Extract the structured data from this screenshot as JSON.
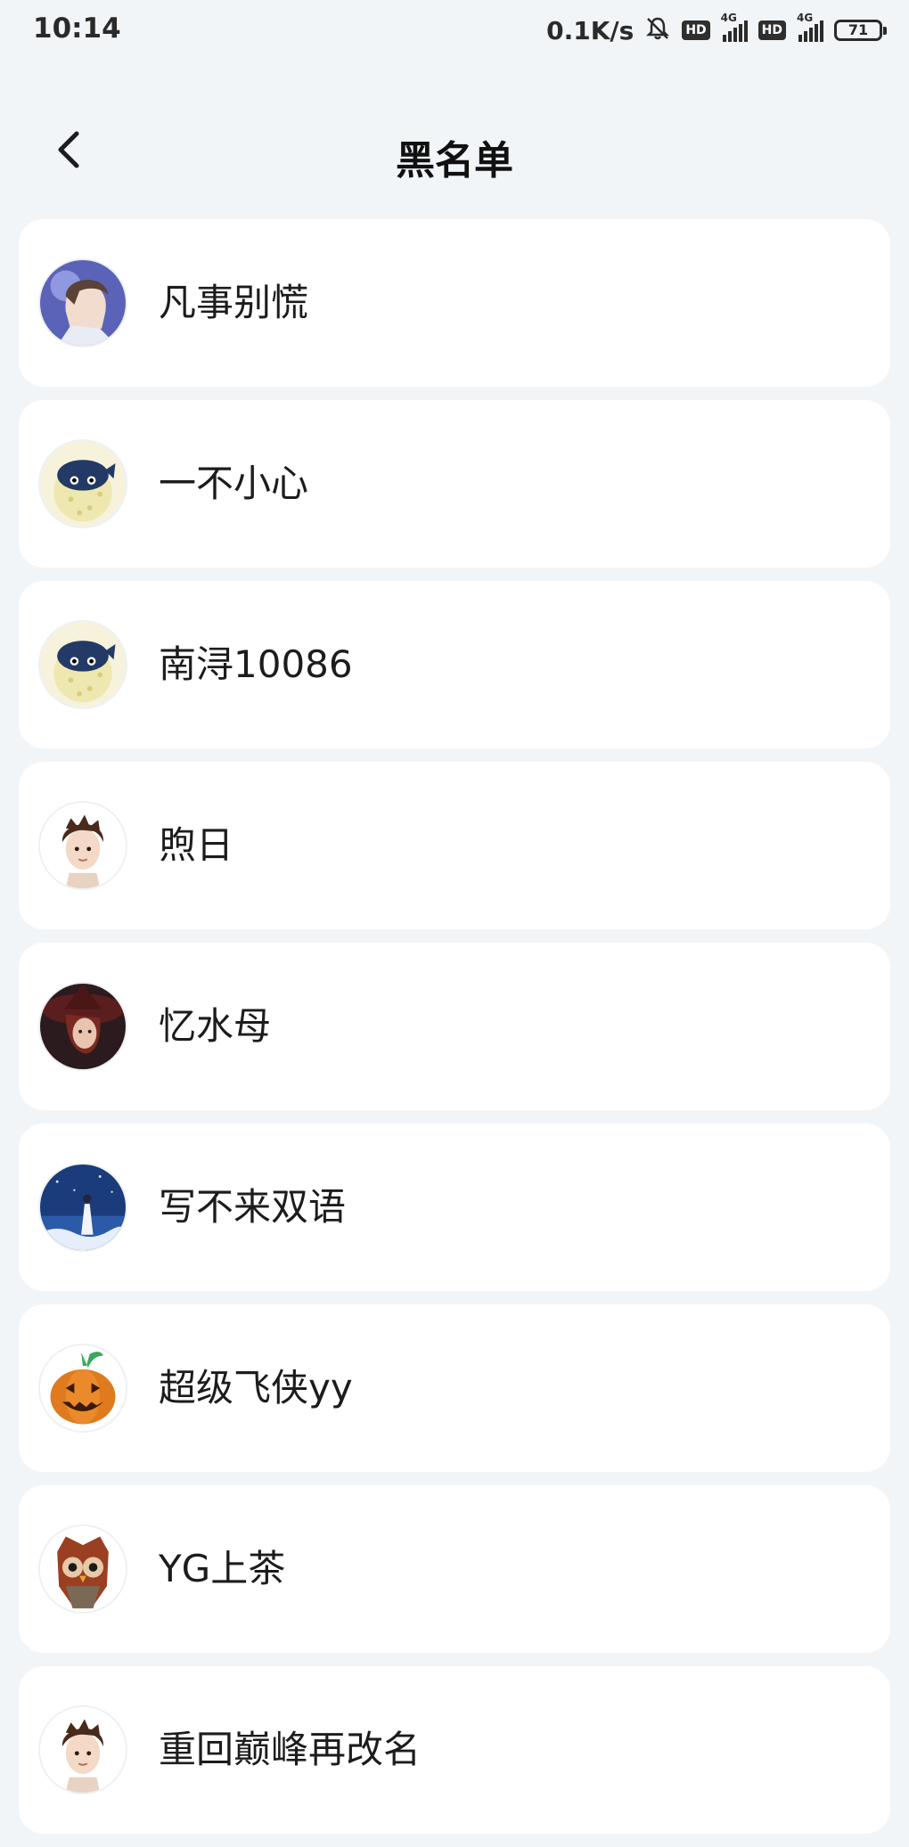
{
  "status_bar": {
    "time": "10:14",
    "net_speed": "0.1K/s",
    "hd1": "HD",
    "net1": "4G",
    "hd2": "HD",
    "net2": "4G",
    "battery": "71"
  },
  "header": {
    "title": "黑名单",
    "back_icon": "chevron-left-icon"
  },
  "blacklist": [
    {
      "name": "凡事别慌",
      "avatar": "anime-boy-avatar"
    },
    {
      "name": "一不小心",
      "avatar": "pufferfish-avatar"
    },
    {
      "name": "南浔10086",
      "avatar": "pufferfish-avatar"
    },
    {
      "name": "煦日",
      "avatar": "cartoon-boy-avatar"
    },
    {
      "name": "忆水母",
      "avatar": "witch-girl-avatar"
    },
    {
      "name": "写不来双语",
      "avatar": "night-sea-avatar"
    },
    {
      "name": "超级飞侠yy",
      "avatar": "pumpkin-avatar"
    },
    {
      "name": "YG上茶",
      "avatar": "owl-avatar"
    },
    {
      "name": "重回巅峰再改名",
      "avatar": "cartoon-boy-avatar"
    }
  ]
}
